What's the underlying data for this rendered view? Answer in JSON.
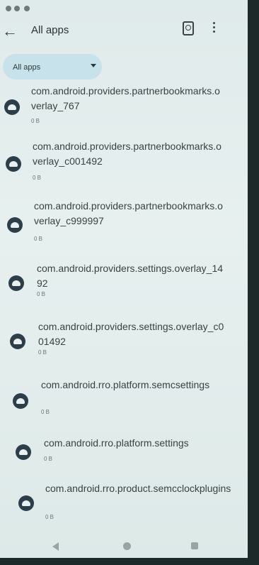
{
  "header": {
    "title": "All apps"
  },
  "filter": {
    "label": "All apps"
  },
  "apps": [
    {
      "name": "com.android.providers.partnerbookmarks.overlay_767",
      "size": "0 B"
    },
    {
      "name": "com.android.providers.partnerbookmarks.overlay_c001492",
      "size": "0 B"
    },
    {
      "name": "com.android.providers.partnerbookmarks.overlay_c999997",
      "size": "0 B"
    },
    {
      "name": "com.android.providers.settings.overlay_1492",
      "size": "0 B"
    },
    {
      "name": "com.android.providers.settings.overlay_c001492",
      "size": "0 B"
    },
    {
      "name": "com.android.rro.platform.semcsettings",
      "size": "0 B"
    },
    {
      "name": "com.android.rro.platform.settings",
      "size": "0 B"
    },
    {
      "name": "com.android.rro.product.semcclockplugins",
      "size": "0 B"
    }
  ],
  "icons": {
    "back": "back-arrow-icon",
    "search": "search-apps-icon",
    "more": "more-vert-icon",
    "dropdown": "caret-down-icon",
    "app": "android-app-icon"
  }
}
